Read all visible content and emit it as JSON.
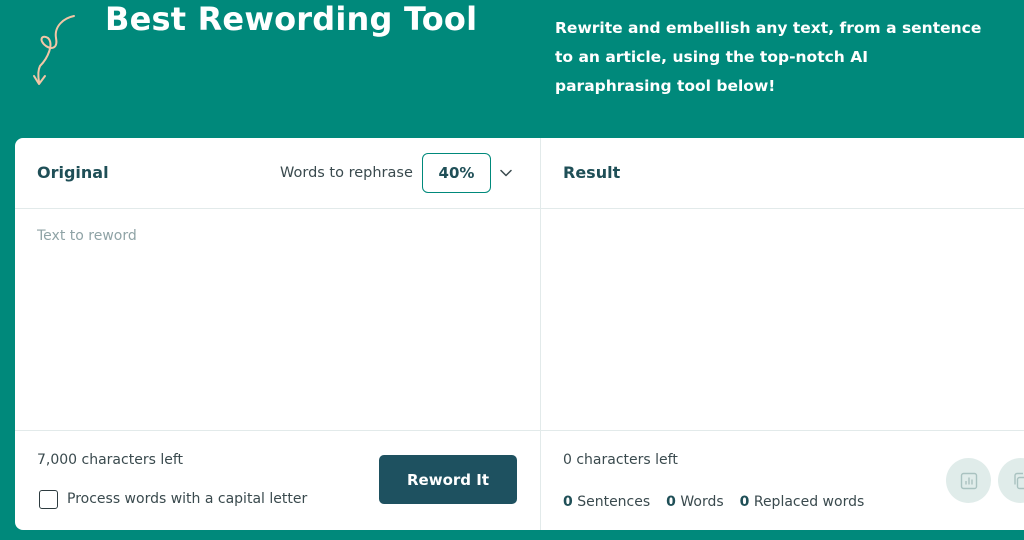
{
  "header": {
    "title": "Best Rewording Tool",
    "subtitle": "Rewrite and embellish any text, from a sentence to an article, using the top-notch AI paraphrasing tool below!"
  },
  "original": {
    "heading": "Original",
    "words_to_rephrase_label": "Words to rephrase",
    "words_to_rephrase_value": "40%",
    "placeholder": "Text to reword",
    "chars_left": "7,000 characters left",
    "capital_checkbox_label": "Process words with a capital letter",
    "capital_checkbox_checked": false,
    "reword_button": "Reword It"
  },
  "result": {
    "heading": "Result",
    "chars_left": "0 characters left",
    "sentences_count": "0",
    "sentences_label": "Sentences",
    "words_count": "0",
    "words_label": "Words",
    "replaced_count": "0",
    "replaced_label": "Replaced words"
  },
  "icons": {
    "decor": "curly-arrow-icon",
    "dropdown": "chevron-down-icon",
    "stats": "bar-chart-icon",
    "copy": "copy-icon"
  },
  "colors": {
    "background": "#00897b",
    "button": "#1e5160",
    "heading": "#1f4f57"
  }
}
